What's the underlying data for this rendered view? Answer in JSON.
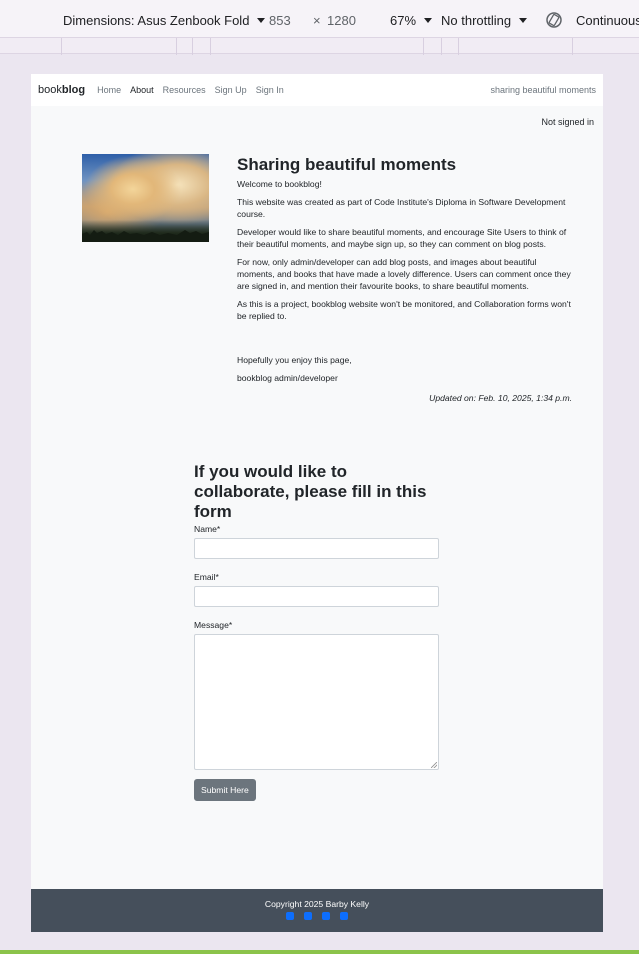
{
  "devtools": {
    "dimensions_label": "Dimensions: Asus Zenbook Fold",
    "width": "853",
    "times": "×",
    "height": "1280",
    "zoom": "67%",
    "throttling": "No throttling",
    "mode": "Continuous"
  },
  "nav": {
    "brand_light": "book",
    "brand_bold": "blog",
    "links": [
      "Home",
      "About",
      "Resources",
      "Sign Up",
      "Sign In"
    ],
    "tagline": "sharing beautiful moments"
  },
  "status": "Not signed in",
  "article": {
    "title": "Sharing beautiful moments",
    "paragraphs": [
      "Welcome to bookblog!",
      "This website was created as part of Code Institute's Diploma in Software Development course.",
      "Developer would like to share beautiful moments, and encourage Site Users to think of their beautiful moments, and maybe sign up, so they can comment on blog posts.",
      "For now, only admin/developer can add blog posts, and images about beautiful moments, and books that have made a lovely difference. Users can comment once they are signed in, and mention their favourite books, to share beautiful moments.",
      "As this is a project, bookblog website won't be monitored, and Collaboration forms won't be replied to."
    ],
    "closing": "Hopefully you enjoy this page,",
    "signoff": "bookblog admin/developer",
    "updated": "Updated on: Feb. 10, 2025, 1:34 p.m."
  },
  "form": {
    "title": "If you would like to collaborate, please fill in this form",
    "name_label": "Name*",
    "email_label": "Email*",
    "message_label": "Message*",
    "submit_label": "Submit Here"
  },
  "footer": {
    "copyright": "Copyright 2025 Barby Kelly"
  }
}
